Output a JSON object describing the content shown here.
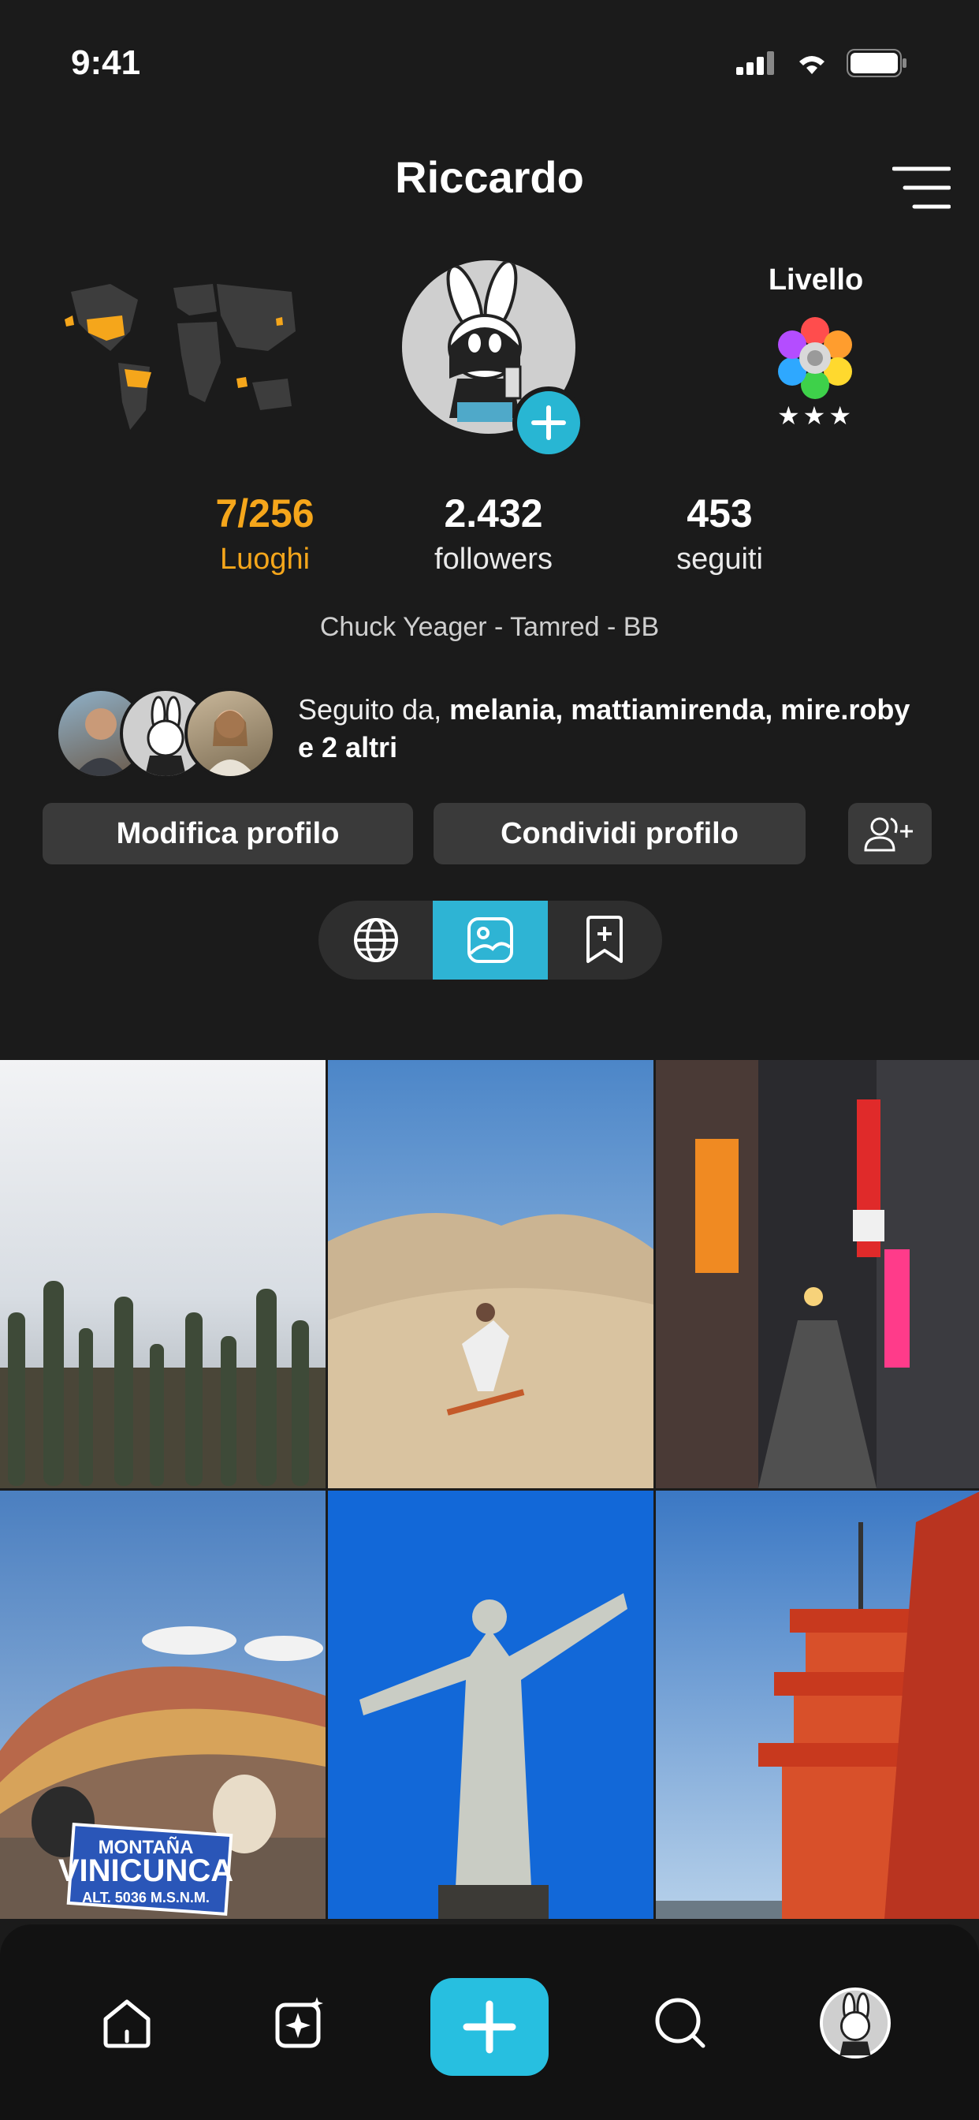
{
  "status_bar": {
    "time": "9:41"
  },
  "header": {
    "title": "Riccardo"
  },
  "level": {
    "label": "Livello",
    "stars": "★★★"
  },
  "stats": [
    {
      "value": "7/256",
      "label": "Luoghi"
    },
    {
      "value": "2.432",
      "label": "followers"
    },
    {
      "value": "453",
      "label": "seguiti"
    }
  ],
  "bio": "Chuck Yeager - Tamred - BB",
  "followed_by": {
    "prefix": "Seguito da, ",
    "names": "melania, mattiamirenda, mire.roby e 2 altri"
  },
  "buttons": {
    "edit": "Modifica profilo",
    "share": "Condividi profilo"
  },
  "tabs": {
    "active": "photos"
  },
  "photos": [
    {
      "subject": "salt-flat-cacti"
    },
    {
      "subject": "sandboarding-dunes"
    },
    {
      "subject": "tokyo-alley-night"
    },
    {
      "subject": "vinicunca-rainbow-mountain",
      "sign_line1": "MONTAÑA",
      "sign_line2": "VINICUNCA",
      "sign_line3": "ALT. 5036 M.S.N.M."
    },
    {
      "subject": "christ-the-redeemer"
    },
    {
      "subject": "japanese-pagoda"
    }
  ],
  "colors": {
    "background": "#1b1b1b",
    "accent": "#2eb4d4",
    "places": "#f5a61b",
    "button": "#3a3a3a"
  },
  "icons": {
    "menu": "menu-icon",
    "add_friend": "add-user-icon",
    "tab1": "globe-icon",
    "tab2": "image-icon",
    "tab3": "bookmark-add-icon",
    "nav": [
      "home-icon",
      "sparkle-image-icon",
      "plus-icon",
      "search-icon",
      "profile-avatar"
    ]
  }
}
